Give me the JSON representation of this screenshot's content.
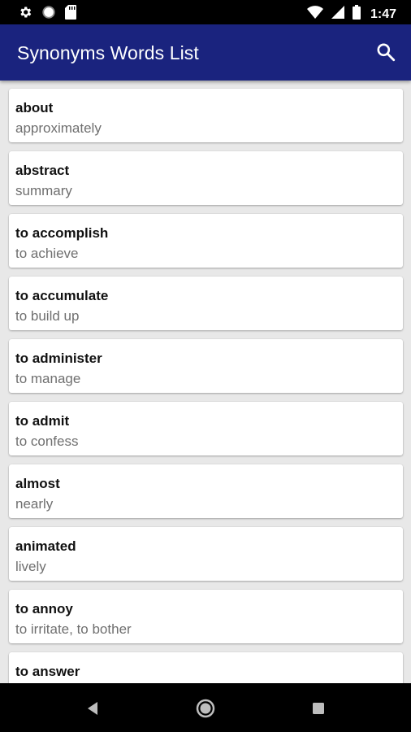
{
  "status_bar": {
    "time": "1:47",
    "left_icons": [
      "gear-icon",
      "circle-icon",
      "sd-card-icon"
    ],
    "right_icons": [
      "wifi-icon",
      "signal-icon",
      "battery-icon"
    ]
  },
  "app_bar": {
    "title": "Synonyms Words List",
    "search_icon": "search-icon",
    "color": "#1a237e"
  },
  "words": [
    {
      "word": "about",
      "synonym": "approximately"
    },
    {
      "word": "abstract",
      "synonym": "summary"
    },
    {
      "word": "to accomplish",
      "synonym": "to achieve"
    },
    {
      "word": "to accumulate",
      "synonym": "to build up"
    },
    {
      "word": "to administer",
      "synonym": "to manage"
    },
    {
      "word": "to admit",
      "synonym": "to confess"
    },
    {
      "word": "almost",
      "synonym": "nearly"
    },
    {
      "word": "animated",
      "synonym": "lively"
    },
    {
      "word": "to annoy",
      "synonym": "to irritate, to bother"
    },
    {
      "word": "to answer",
      "synonym": ""
    }
  ],
  "nav_bar": {
    "buttons": [
      "back-icon",
      "home-icon",
      "recents-icon"
    ]
  }
}
